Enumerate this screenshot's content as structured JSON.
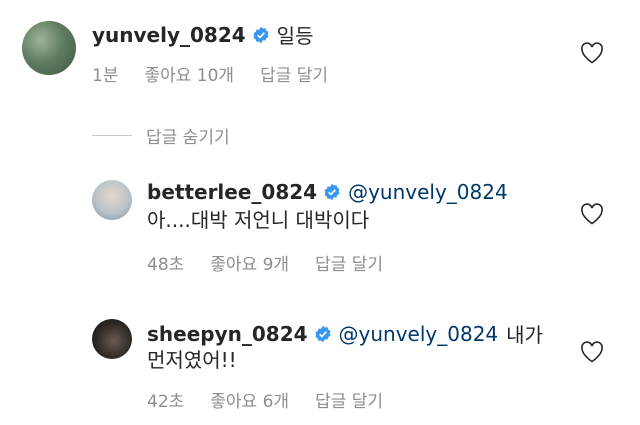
{
  "comment1": {
    "username": "yunvely_0824",
    "text": "일등",
    "time": "1분",
    "likes": "좋아요 10개",
    "reply": "답글 달기"
  },
  "hide_replies": "답글 숨기기",
  "reply1": {
    "username": "betterlee_0824",
    "mention": "@yunvely_0824",
    "text": "아....대박 저언니 대박이다",
    "time": "48초",
    "likes": "좋아요 9개",
    "reply": "답글 달기"
  },
  "reply2": {
    "username": "sheepyn_0824",
    "mention": "@yunvely_0824",
    "text_part1": "내가",
    "text_part2": "먼저였어!!",
    "time": "42초",
    "likes": "좋아요 6개",
    "reply": "답글 달기"
  },
  "colors": {
    "verified_badge": "#3897f0",
    "mention": "#00376b",
    "meta_text": "#8e8e8e"
  },
  "icons": [
    "verified-badge-icon",
    "heart-outline-icon"
  ]
}
